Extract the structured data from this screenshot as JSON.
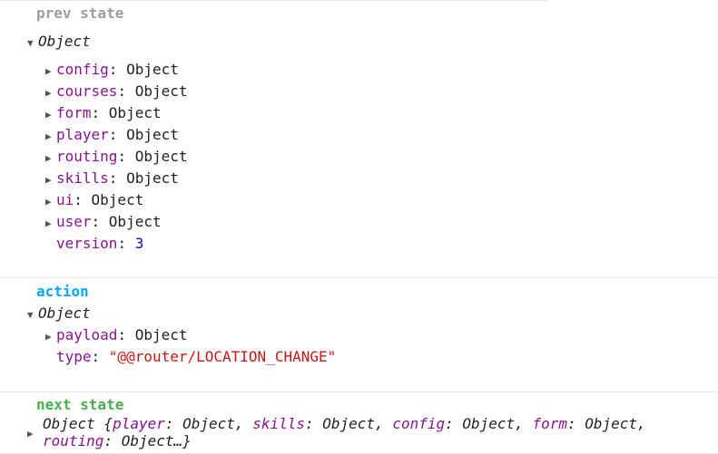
{
  "prev_state": {
    "label": "prev state",
    "label_color": "#9e9e9e",
    "root": "Object",
    "items": [
      {
        "key": "config",
        "value": "Object"
      },
      {
        "key": "courses",
        "value": "Object"
      },
      {
        "key": "form",
        "value": "Object"
      },
      {
        "key": "player",
        "value": "Object"
      },
      {
        "key": "routing",
        "value": "Object"
      },
      {
        "key": "skills",
        "value": "Object"
      },
      {
        "key": "ui",
        "value": "Object"
      },
      {
        "key": "user",
        "value": "Object"
      }
    ],
    "version_key": "version",
    "version_value": "3"
  },
  "action": {
    "label": "action",
    "label_color": "#03a9f4",
    "root": "Object",
    "payload_key": "payload",
    "payload_value": "Object",
    "type_key": "type",
    "type_value": "\"@@router/LOCATION_CHANGE\""
  },
  "next_state": {
    "label": "next state",
    "label_color": "#4caf50",
    "root": "Object {",
    "preview": [
      {
        "key": "player",
        "value": "Object"
      },
      {
        "key": "skills",
        "value": "Object"
      },
      {
        "key": "config",
        "value": "Object"
      },
      {
        "key": "form",
        "value": "Object"
      },
      {
        "key": "routing",
        "value": "Object…}"
      }
    ]
  },
  "icons": {
    "expanded": "triangle-down-icon",
    "collapsed": "triangle-right-icon"
  },
  "colors": {
    "key": "#881391",
    "number": "#1c00cf",
    "string": "#c41a16"
  }
}
